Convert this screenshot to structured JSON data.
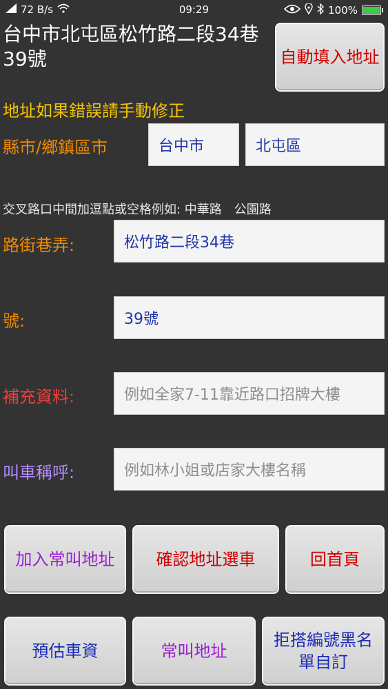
{
  "status_bar": {
    "net_speed": "72 B/s",
    "time": "09:29",
    "battery": "100%",
    "battery_fill": 1.0,
    "icons": [
      "signal-icon",
      "wifi-icon",
      "eye-icon",
      "location-icon",
      "bluetooth-icon",
      "battery-icon"
    ]
  },
  "header": {
    "address_text": "台中市北屯區松竹路二段34巷39號",
    "autofill_button": "自動填入地址"
  },
  "form": {
    "correction_note": "地址如果錯誤請手動修正",
    "county_label": "縣市/鄉鎮區市",
    "city_value": "台中市",
    "district_value": "北屯區",
    "intersection_hint": "交叉路口中間加逗點或空格例如: 中華路　公園路",
    "road_label": "路街巷弄:",
    "road_value": "松竹路二段34巷",
    "number_label": "號:",
    "number_value": "39號",
    "extra_label": "補充資料:",
    "extra_placeholder": "例如全家7-11靠近路口招牌大樓",
    "callname_label": "叫車稱呼:",
    "callname_placeholder": "例如林小姐或店家大樓名稱"
  },
  "buttons": {
    "add_frequent": "加入常叫地址",
    "confirm_select": "確認地址選車",
    "home": "回首頁",
    "estimate_fare": "預估車資",
    "frequent_addresses": "常叫地址",
    "blacklist": "拒搭編號黑名單自訂"
  },
  "colors": {
    "background": "#333333",
    "yellow": "#f5c400",
    "orange": "#f08a00",
    "red": "#d00000",
    "purple": "#9b1fd1",
    "blue": "#1c2bb7"
  }
}
